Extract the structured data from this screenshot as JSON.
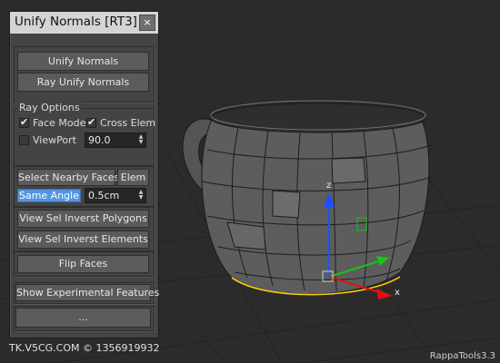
{
  "panel": {
    "title": "Unify Normals [RT3]",
    "close_glyph": "×",
    "buttons": {
      "unify_normals": "Unify Normals",
      "ray_unify_normals": "Ray Unify Normals",
      "select_nearby_faces": "Select Nearby Faces",
      "elem": "Elem",
      "same_angle": "Same Angle",
      "view_sel_invert_polygons": "View Sel Inverst Polygons",
      "view_sel_invert_elements": "View Sel Inverst Elements",
      "flip_faces": "Flip Faces",
      "show_experimental": "Show Experimental Features",
      "more": "..."
    },
    "ray_options": {
      "group_label": "Ray Options",
      "face_mode": {
        "label": "Face Mode",
        "checked": true
      },
      "cross_elem": {
        "label": "Cross Elem",
        "checked": true
      },
      "viewport": {
        "label": "ViewPort",
        "checked": false
      },
      "angle_value": "90.0"
    },
    "distance_value": "0.5cm"
  },
  "viewport": {
    "watermark": "TK.V5CG.COM © 1356919932",
    "brand": "RappaTools3.3",
    "gizmo": {
      "z_label": "z",
      "x_label": "x"
    },
    "colors": {
      "background": "#2b2b2b",
      "mesh_fill": "#5a5a5a",
      "z_axis": "#1f4fff",
      "x_axis": "#e01010",
      "y_axis": "#14c814",
      "highlight": "#ffd200"
    }
  }
}
